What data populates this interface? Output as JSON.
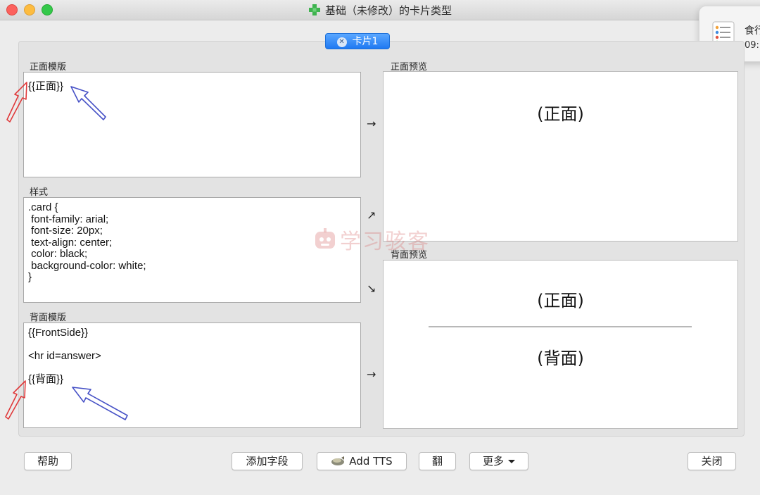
{
  "window": {
    "title": "基础（未修改）的卡片类型"
  },
  "notification": {
    "title": "食行",
    "time": "09:"
  },
  "tab": {
    "label": "卡片1"
  },
  "sections": {
    "front_template": "正面模版",
    "styling": "样式",
    "back_template": "背面模版",
    "front_preview": "正面预览",
    "back_preview": "背面预览"
  },
  "editors": {
    "front": "{{正面}}",
    "styling": ".card {\n font-family: arial;\n font-size: 20px;\n text-align: center;\n color: black;\n background-color: white;\n}",
    "back": "{{FrontSide}}\n\n<hr id=answer>\n\n{{背面}}"
  },
  "previews": {
    "front_text": "(正面)",
    "back_front_text": "(正面)",
    "back_back_text": "(背面)"
  },
  "arrows": {
    "front": "→",
    "style_up": "↗",
    "style_down": "↘",
    "back": "→"
  },
  "watermark": "学习骇客",
  "buttons": {
    "help": "帮助",
    "add_field": "添加字段",
    "add_tts": "Add TTS",
    "flip": "翻",
    "more": "更多",
    "close": "关闭"
  },
  "icons": {
    "window": "green-plus-icon",
    "notification": "reminders-icon",
    "tab_close": "close-icon",
    "tts": "speaker-icon",
    "more": "chevron-down-icon"
  },
  "colors": {
    "tab_accent": "#2784f7",
    "annotation_red": "#e0393a",
    "annotation_blue": "#4651c6"
  }
}
